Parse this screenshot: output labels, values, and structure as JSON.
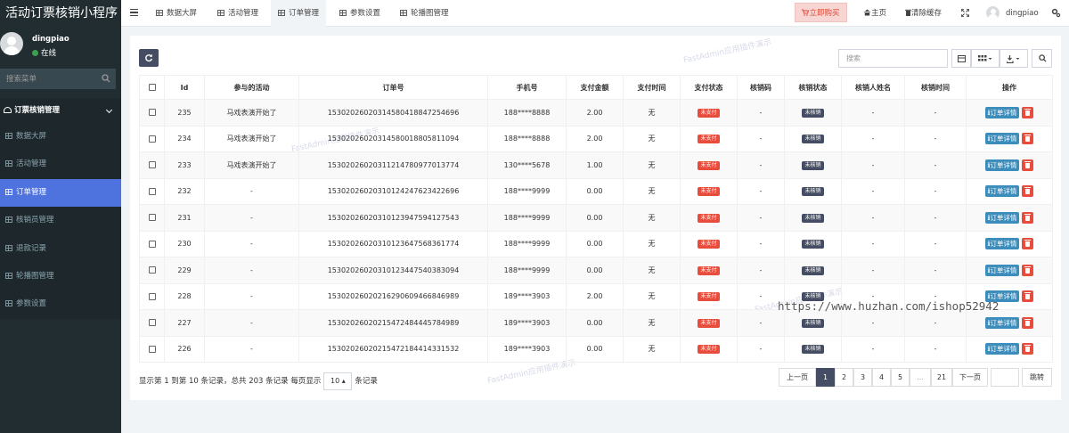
{
  "app": {
    "title": "活动订票核销小程序"
  },
  "user": {
    "name": "dingpiao",
    "status": "在线"
  },
  "sidebar": {
    "search_placeholder": "搜索菜单",
    "group": "订票核销管理",
    "items": [
      {
        "label": "数据大屏"
      },
      {
        "label": "活动管理"
      },
      {
        "label": "订单管理",
        "active": true
      },
      {
        "label": "核销员管理"
      },
      {
        "label": "退款记录"
      },
      {
        "label": "轮播图管理"
      },
      {
        "label": "参数设置"
      }
    ]
  },
  "topbar": {
    "tabs": [
      "数据大屏",
      "活动管理",
      "订单管理",
      "参数设置",
      "轮播图管理"
    ],
    "buy_label": "立即购买",
    "home_label": "主页",
    "clear_cache_label": "清除缓存",
    "username": "dingpiao"
  },
  "toolbar": {
    "search_placeholder": "搜索"
  },
  "table": {
    "columns": [
      "Id",
      "参与的活动",
      "订单号",
      "手机号",
      "支付金额",
      "支付时间",
      "支付状态",
      "核销码",
      "核销状态",
      "核销人姓名",
      "核销时间",
      "操作"
    ],
    "rows": [
      {
        "id": "235",
        "activity": "马戏表演开始了",
        "order_no": "15302026020314580418847254696",
        "phone": "188****8888",
        "amount": "2.00",
        "pay_time": "无",
        "pay_status": "未支付",
        "code": "-",
        "verify_status": "未核销",
        "verifier": "-",
        "verify_time": "-"
      },
      {
        "id": "234",
        "activity": "马戏表演开始了",
        "order_no": "15302026020314580018805811094",
        "phone": "188****8888",
        "amount": "2.00",
        "pay_time": "无",
        "pay_status": "未支付",
        "code": "-",
        "verify_status": "未核销",
        "verifier": "-",
        "verify_time": "-"
      },
      {
        "id": "233",
        "activity": "马戏表演开始了",
        "order_no": "15302026020311214780977013774",
        "phone": "130****5678",
        "amount": "1.00",
        "pay_time": "无",
        "pay_status": "未支付",
        "code": "-",
        "verify_status": "未核销",
        "verifier": "-",
        "verify_time": "-"
      },
      {
        "id": "232",
        "activity": "-",
        "order_no": "15302026020310124247623422696",
        "phone": "188****9999",
        "amount": "0.00",
        "pay_time": "无",
        "pay_status": "未支付",
        "code": "-",
        "verify_status": "未核销",
        "verifier": "-",
        "verify_time": "-"
      },
      {
        "id": "231",
        "activity": "-",
        "order_no": "15302026020310123947594127543",
        "phone": "188****9999",
        "amount": "0.00",
        "pay_time": "无",
        "pay_status": "未支付",
        "code": "-",
        "verify_status": "未核销",
        "verifier": "-",
        "verify_time": "-"
      },
      {
        "id": "230",
        "activity": "-",
        "order_no": "15302026020310123647568361774",
        "phone": "188****9999",
        "amount": "0.00",
        "pay_time": "无",
        "pay_status": "未支付",
        "code": "-",
        "verify_status": "未核销",
        "verifier": "-",
        "verify_time": "-"
      },
      {
        "id": "229",
        "activity": "-",
        "order_no": "15302026020310123447540383094",
        "phone": "188****9999",
        "amount": "0.00",
        "pay_time": "无",
        "pay_status": "未支付",
        "code": "-",
        "verify_status": "未核销",
        "verifier": "-",
        "verify_time": "-"
      },
      {
        "id": "228",
        "activity": "-",
        "order_no": "15302026020216290609466846989",
        "phone": "189****3903",
        "amount": "2.00",
        "pay_time": "无",
        "pay_status": "未支付",
        "code": "-",
        "verify_status": "未核销",
        "verifier": "-",
        "verify_time": "-"
      },
      {
        "id": "227",
        "activity": "-",
        "order_no": "15302026020215472484445784989",
        "phone": "189****3903",
        "amount": "0.00",
        "pay_time": "无",
        "pay_status": "未支付",
        "code": "-",
        "verify_status": "未核销",
        "verifier": "-",
        "verify_time": "-"
      },
      {
        "id": "226",
        "activity": "-",
        "order_no": "15302026020215472184414331532",
        "phone": "189****3903",
        "amount": "0.00",
        "pay_time": "无",
        "pay_status": "未支付",
        "code": "-",
        "verify_status": "未核销",
        "verifier": "-",
        "verify_time": "-"
      }
    ],
    "detail_label": "订单详情"
  },
  "pagination": {
    "summary_prefix": "显示第 1 到第 10 条记录，总共 203 条记录 每页显示",
    "page_size": "10",
    "summary_suffix": "条记录",
    "prev": "上一页",
    "pages": [
      "1",
      "2",
      "3",
      "4",
      "5",
      "...",
      "21"
    ],
    "next": "下一页",
    "goto": "跳转"
  },
  "watermark": "FastAdmin应用插件演示",
  "overlay_url": "https://www.huzhan.com/ishop52942",
  "colors": {
    "sidebar": "#222d32",
    "active": "#4e73df",
    "danger": "#e74c3c",
    "primary": "#3c8dbc",
    "dark": "#444d63"
  }
}
